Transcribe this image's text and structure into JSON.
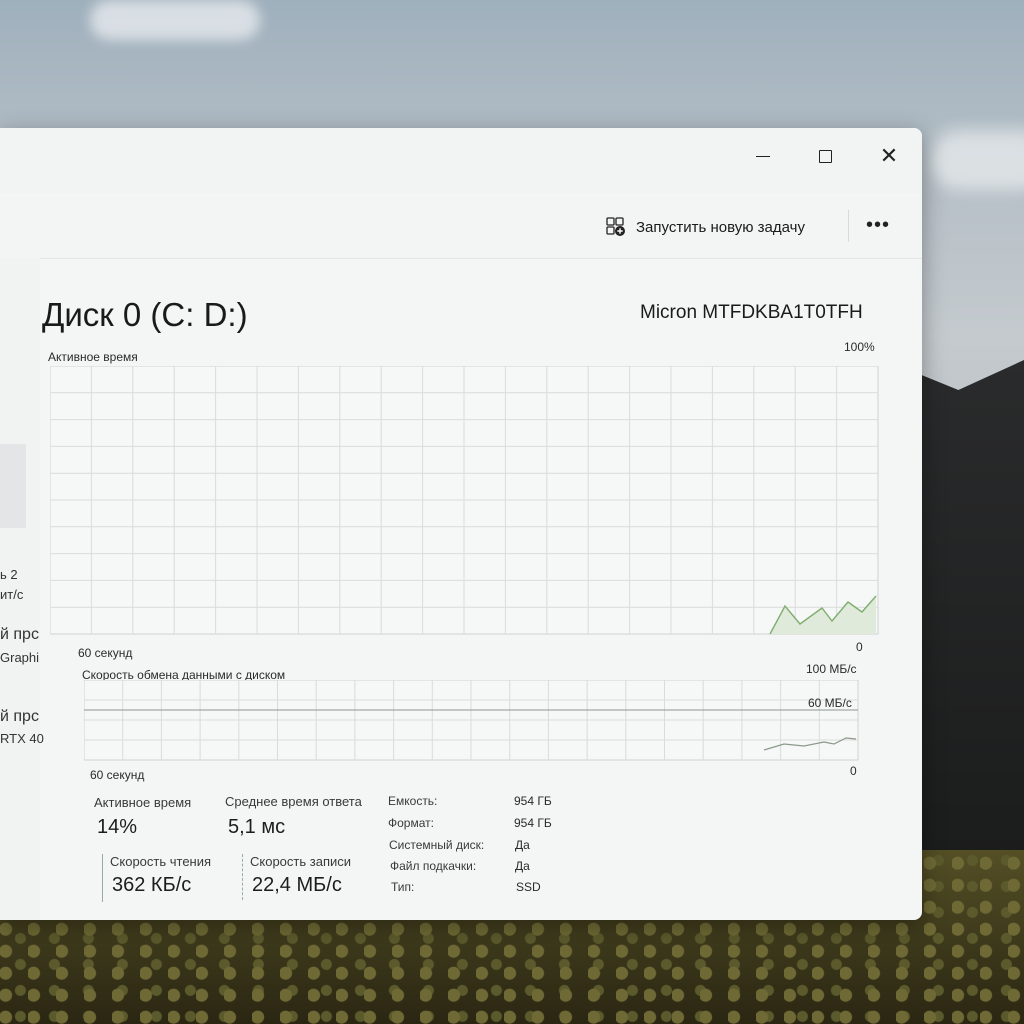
{
  "window": {
    "controls": {
      "minimize": "minimize",
      "maximize": "maximize",
      "close": "✕"
    }
  },
  "toolbar": {
    "run_task_label": "Запустить новую задачу",
    "more_label": "•••"
  },
  "sidebar": {
    "partial_lines": [
      {
        "text": "ь 2"
      },
      {
        "text": "ит/с"
      },
      {
        "text": "й прс"
      },
      {
        "text": "Graphi"
      },
      {
        "text": "й прс"
      },
      {
        "text": "RTX 40"
      }
    ]
  },
  "disk": {
    "title": "Диск 0 (C: D:)",
    "model": "Micron MTFDKBA1T0TFH"
  },
  "active_time_chart": {
    "label": "Активное время",
    "max_label": "100%",
    "x_label": "60 секунд",
    "min_label": "0"
  },
  "transfer_chart": {
    "label": "Скорость обмена данными с диском",
    "max_label": "100 МБ/с",
    "mid_label": "60 МБ/с",
    "x_label": "60 секунд",
    "min_label": "0"
  },
  "stats": {
    "active_time": {
      "label": "Активное время",
      "value": "14%"
    },
    "response_time": {
      "label": "Среднее время ответа",
      "value": "5,1 мс"
    },
    "read_speed": {
      "label": "Скорость чтения",
      "value": "362 КБ/с"
    },
    "write_speed": {
      "label": "Скорость записи",
      "value": "22,4 МБ/с"
    }
  },
  "properties": [
    {
      "label": "Емкость:",
      "value": "954 ГБ"
    },
    {
      "label": "Формат:",
      "value": "954 ГБ"
    },
    {
      "label": "Системный диск:",
      "value": "Да"
    },
    {
      "label": "Файл подкачки:",
      "value": "Да"
    },
    {
      "label": "Тип:",
      "value": "SSD"
    }
  ],
  "colors": {
    "graph_line": "#7fae6f",
    "graph_fill": "#dfeadb",
    "grid": "#d9dcdc"
  }
}
